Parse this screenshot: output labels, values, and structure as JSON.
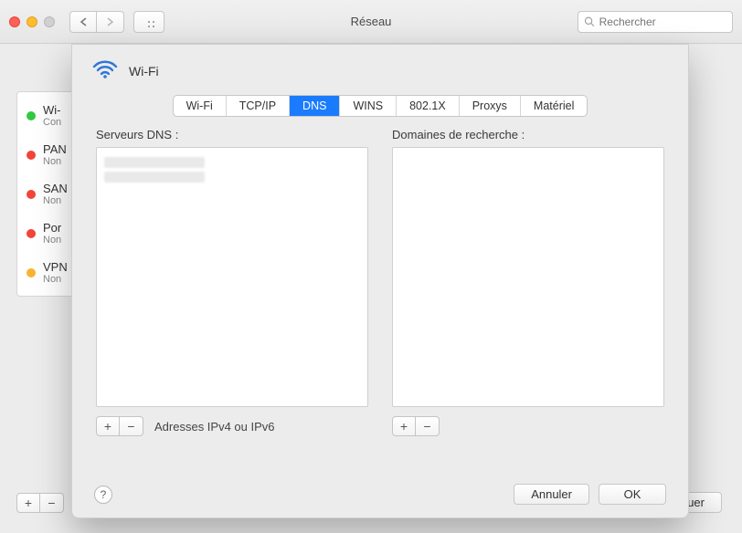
{
  "window": {
    "title": "Réseau",
    "search_placeholder": "Rechercher"
  },
  "sidebar": {
    "items": [
      {
        "title": "Wi-",
        "subtitle": "Con",
        "dot": "green"
      },
      {
        "title": "PAN",
        "subtitle": "Non",
        "dot": "red"
      },
      {
        "title": "SAN",
        "subtitle": "Non",
        "dot": "red"
      },
      {
        "title": "Por",
        "subtitle": "Non",
        "dot": "red"
      },
      {
        "title": "VPN",
        "subtitle": "Non",
        "dot": "orange"
      }
    ]
  },
  "bg_buttons": {
    "apply": "quer"
  },
  "sheet": {
    "title": "Wi-Fi",
    "tabs": [
      {
        "label": "Wi-Fi",
        "active": false
      },
      {
        "label": "TCP/IP",
        "active": false
      },
      {
        "label": "DNS",
        "active": true
      },
      {
        "label": "WINS",
        "active": false
      },
      {
        "label": "802.1X",
        "active": false
      },
      {
        "label": "Proxys",
        "active": false
      },
      {
        "label": "Matériel",
        "active": false
      }
    ],
    "dns": {
      "label": "Serveurs DNS :",
      "hint": "Adresses IPv4 ou IPv6"
    },
    "search_domains": {
      "label": "Domaines de recherche :"
    },
    "buttons": {
      "cancel": "Annuler",
      "ok": "OK"
    }
  }
}
